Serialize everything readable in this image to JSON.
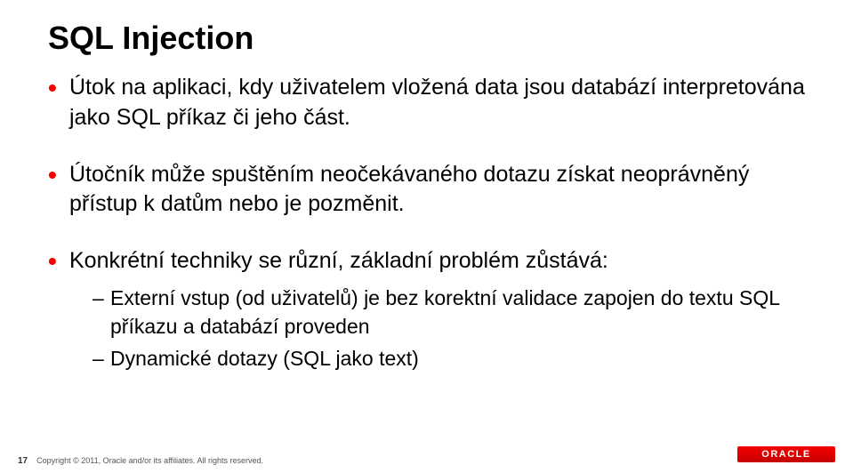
{
  "title": "SQL Injection",
  "bullets": [
    {
      "text": "Útok na aplikaci, kdy uživatelem vložená data jsou databází interpretována jako SQL příkaz či jeho část."
    },
    {
      "text": "Útočník může spuštěním neočekávaného dotazu získat neoprávněný přístup k datům nebo je pozměnit."
    },
    {
      "text": "Konkrétní techniky se různí, základní problém zůstává:",
      "subs": [
        "Externí vstup (od uživatelů) je bez korektní validace zapojen do textu SQL příkazu a databází proveden",
        "Dynamické dotazy (SQL jako text)"
      ]
    }
  ],
  "footer": {
    "page": "17",
    "copyright": "Copyright © 2011, Oracle and/or its affiliates. All rights reserved."
  },
  "logo": "ORACLE"
}
